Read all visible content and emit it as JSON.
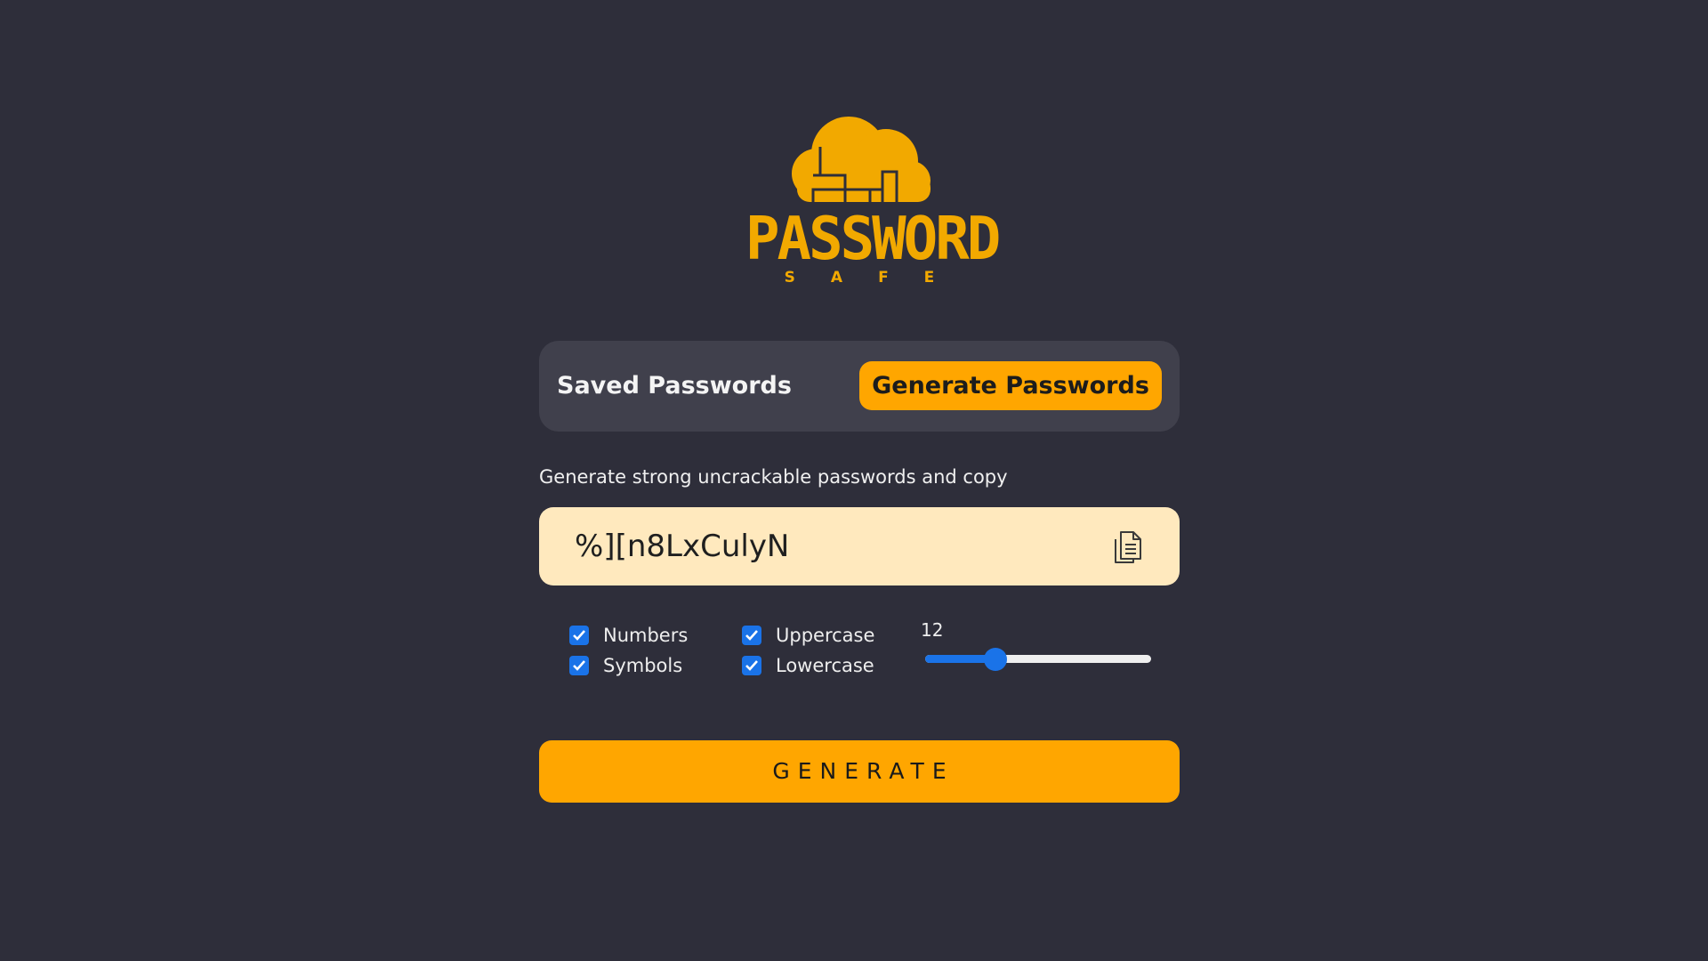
{
  "logo": {
    "word": "PASSWORD",
    "sub": "SAFE",
    "icon": "cloud-lock-logo",
    "color": "#f2a900"
  },
  "tabs": {
    "saved_label": "Saved Passwords",
    "generate_label": "Generate Passwords",
    "active": "Generate Passwords"
  },
  "description": "Generate strong uncrackable passwords and copy",
  "password": {
    "value": "%][n8LxCulyN",
    "copy_icon": "copy-icon"
  },
  "options": {
    "numbers": {
      "label": "Numbers",
      "checked": true
    },
    "symbols": {
      "label": "Symbols",
      "checked": true
    },
    "uppercase": {
      "label": "Uppercase",
      "checked": true
    },
    "lowercase": {
      "label": "Lowercase",
      "checked": true
    }
  },
  "length": {
    "value": "12",
    "fraction": 0.31
  },
  "generate_button": "GENERATE",
  "colors": {
    "background": "#2e2e3a",
    "accent": "#ffa600",
    "field": "#ffe9be",
    "checkbox": "#1a73e8"
  }
}
